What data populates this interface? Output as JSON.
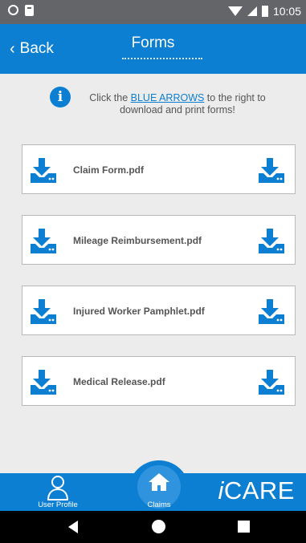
{
  "status_bar": {
    "time": "10:05",
    "icons": [
      "circle-icon",
      "sim-card-icon",
      "wifi-icon",
      "signal-icon",
      "battery-icon"
    ]
  },
  "header": {
    "back_label": "Back",
    "title": "Forms"
  },
  "info": {
    "prefix": "Click the ",
    "link": "BLUE ARROWS",
    "suffix": " to the right to download and print forms!"
  },
  "forms": [
    {
      "name": "Claim Form.pdf"
    },
    {
      "name": "Mileage Reimbursement.pdf"
    },
    {
      "name": "Injured Worker Pamphlet.pdf"
    },
    {
      "name": "Medical Release.pdf"
    }
  ],
  "bottom_nav": {
    "profile_label": "User Profile",
    "claims_label": "Claims",
    "logo": {
      "i": "i",
      "rest": "CARE"
    }
  },
  "colors": {
    "primary": "#0c7fd3",
    "background": "#ececec",
    "status_bar": "#646569"
  }
}
